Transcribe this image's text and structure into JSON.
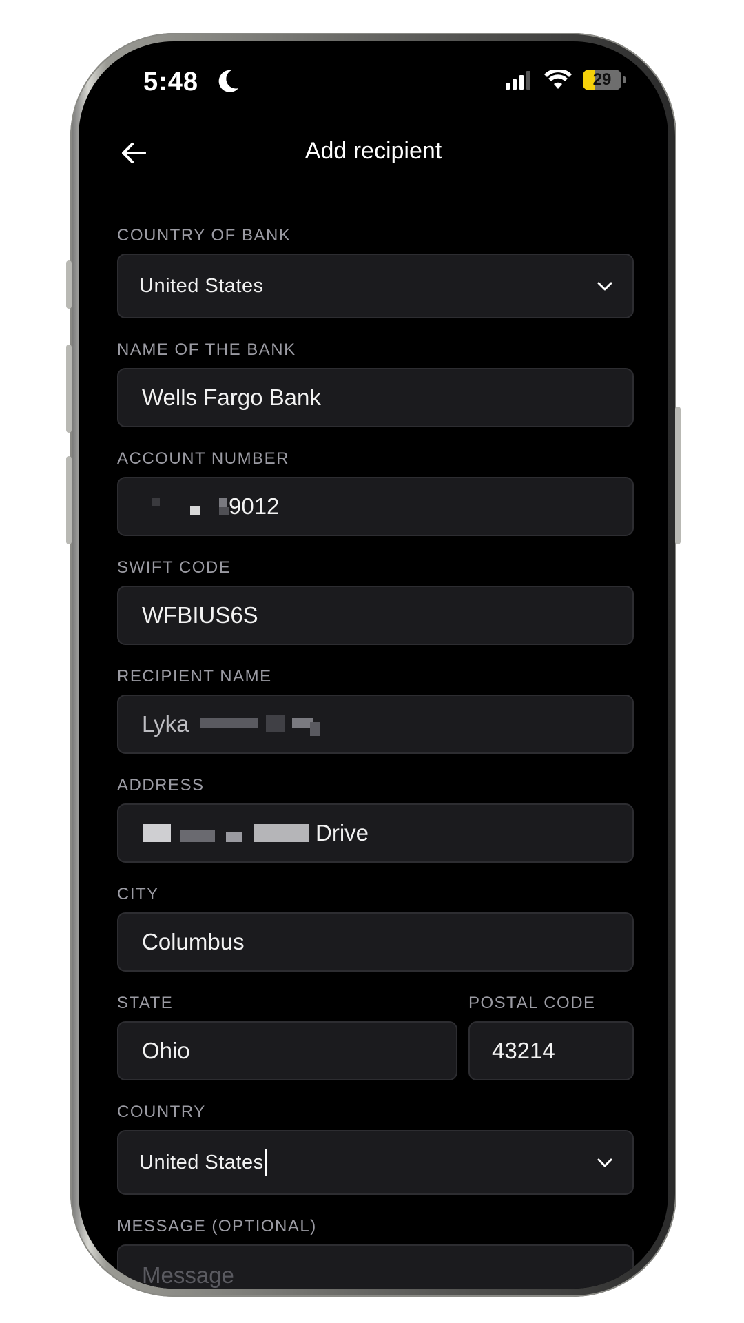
{
  "status_bar": {
    "time": "5:48",
    "battery": "29"
  },
  "header": {
    "title": "Add recipient"
  },
  "form": {
    "country_of_bank": {
      "label": "COUNTRY OF BANK",
      "value": "United States"
    },
    "bank_name": {
      "label": "NAME OF THE BANK",
      "value": "Wells Fargo Bank"
    },
    "account_number": {
      "label": "ACCOUNT NUMBER",
      "value_suffix": "9012"
    },
    "swift_code": {
      "label": "SWIFT CODE",
      "value": "WFBIUS6S"
    },
    "recipient_name": {
      "label": "RECIPIENT NAME",
      "value_visible": "Lyka"
    },
    "address": {
      "label": "ADDRESS",
      "value_suffix": "Drive"
    },
    "city": {
      "label": "CITY",
      "value": "Columbus"
    },
    "state": {
      "label": "STATE",
      "value": "Ohio"
    },
    "postal_code": {
      "label": "POSTAL CODE",
      "value": "43214"
    },
    "country": {
      "label": "COUNTRY",
      "value": "United States"
    },
    "message": {
      "label": "MESSAGE (OPTIONAL)",
      "placeholder": "Message"
    }
  }
}
